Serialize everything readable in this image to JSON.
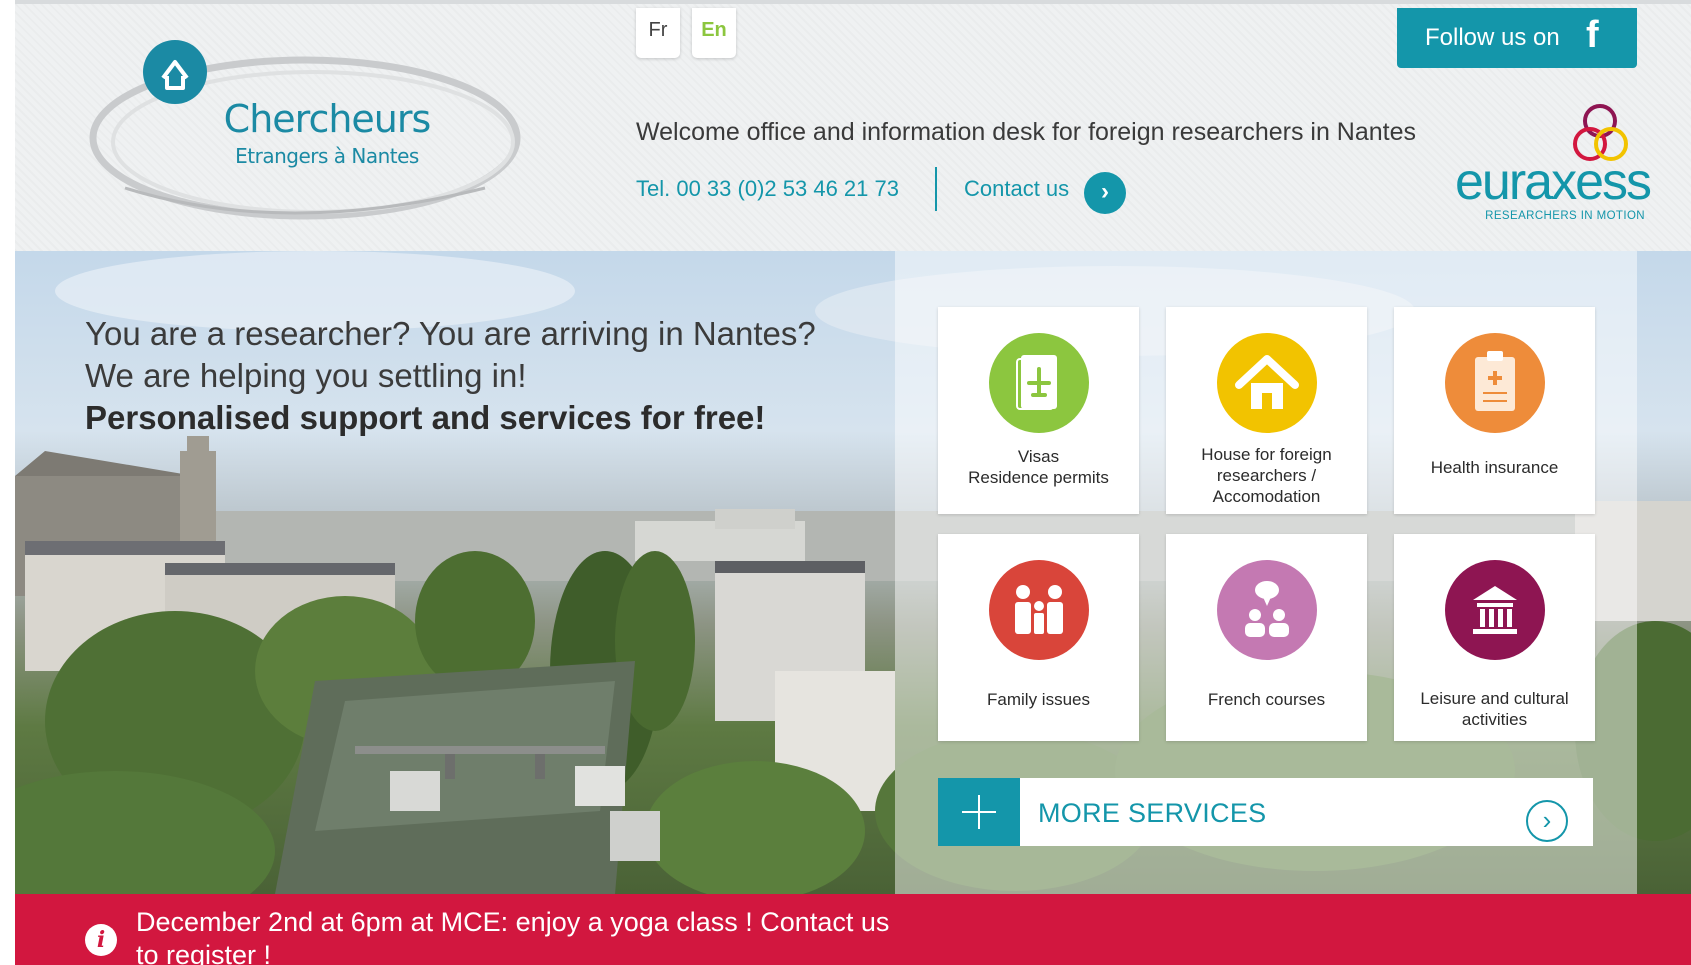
{
  "header": {
    "logo": {
      "title": "Chercheurs",
      "subtitle": "Etrangers à Nantes"
    },
    "languages": {
      "fr": "Fr",
      "en": "En",
      "active": "En"
    },
    "follow": {
      "label": "Follow us on",
      "icon": "facebook-icon",
      "glyph": "f"
    },
    "tagline": "Welcome office and information desk for foreign researchers in Nantes",
    "phone": "Tel. 00 33 (0)2 53 46 21 73",
    "contact": {
      "label": "Contact us",
      "arrow": "›"
    },
    "euraxess": {
      "word": "euraxess",
      "tag": "RESEARCHERS IN MOTION"
    }
  },
  "hero": {
    "line1": "You are a researcher? You are arriving in Nantes?",
    "line2": "We are helping you settling in!",
    "line3": "Personalised support and services for free!"
  },
  "services": [
    {
      "label": "Visas\nResidence permits",
      "icon": "passport-icon",
      "color": "#8cc63f"
    },
    {
      "label": "House for foreign researchers / Accomodation",
      "icon": "house-icon",
      "color": "#f2c300"
    },
    {
      "label": "Health insurance",
      "icon": "clipboard-medical-icon",
      "color": "#ee8c3a"
    },
    {
      "label": "Family issues",
      "icon": "family-icon",
      "color": "#d9453a"
    },
    {
      "label": "French courses",
      "icon": "speech-people-icon",
      "color": "#c479b2"
    },
    {
      "label": "Leisure and cultural activities",
      "icon": "museum-icon",
      "color": "#8e1552"
    }
  ],
  "more_services": {
    "label": "MORE SERVICES",
    "icon": "plus-icon",
    "arrow": "›"
  },
  "alert": {
    "icon": "info-icon",
    "glyph": "i",
    "text": "December 2nd at 6pm at MCE: enjoy a yoga class ! Contact us to register !"
  },
  "colors": {
    "teal": "#1496aa",
    "alert": "#d2173f",
    "lang_active": "#8cc63f"
  }
}
